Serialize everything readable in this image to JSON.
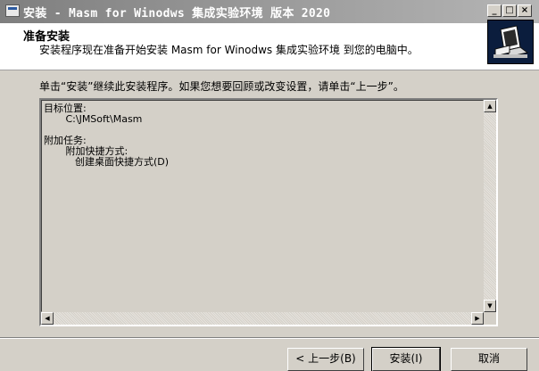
{
  "window": {
    "title": "安装 - Masm for Winodws 集成实验环境 版本 2020"
  },
  "titlebar_buttons": {
    "minimize": "_",
    "maximize": "□",
    "close": "×"
  },
  "header": {
    "title": "准备安装",
    "subtitle": "安装程序现在准备开始安装 Masm for Winodws 集成实验环境 到您的电脑中。"
  },
  "instruction": "单击“安装”继续此安装程序。如果您想要回顾或改变设置，请单击“上一步”。",
  "memo": {
    "text": "目标位置:\n       C:\\JMSoft\\Masm\n\n附加任务:\n       附加快捷方式:\n          创建桌面快捷方式(D)"
  },
  "scroll": {
    "up": "▲",
    "down": "▼",
    "left": "◀",
    "right": "▶"
  },
  "buttons": {
    "back": "< 上一步(B)",
    "install": "安装(I)",
    "cancel": "取消"
  }
}
